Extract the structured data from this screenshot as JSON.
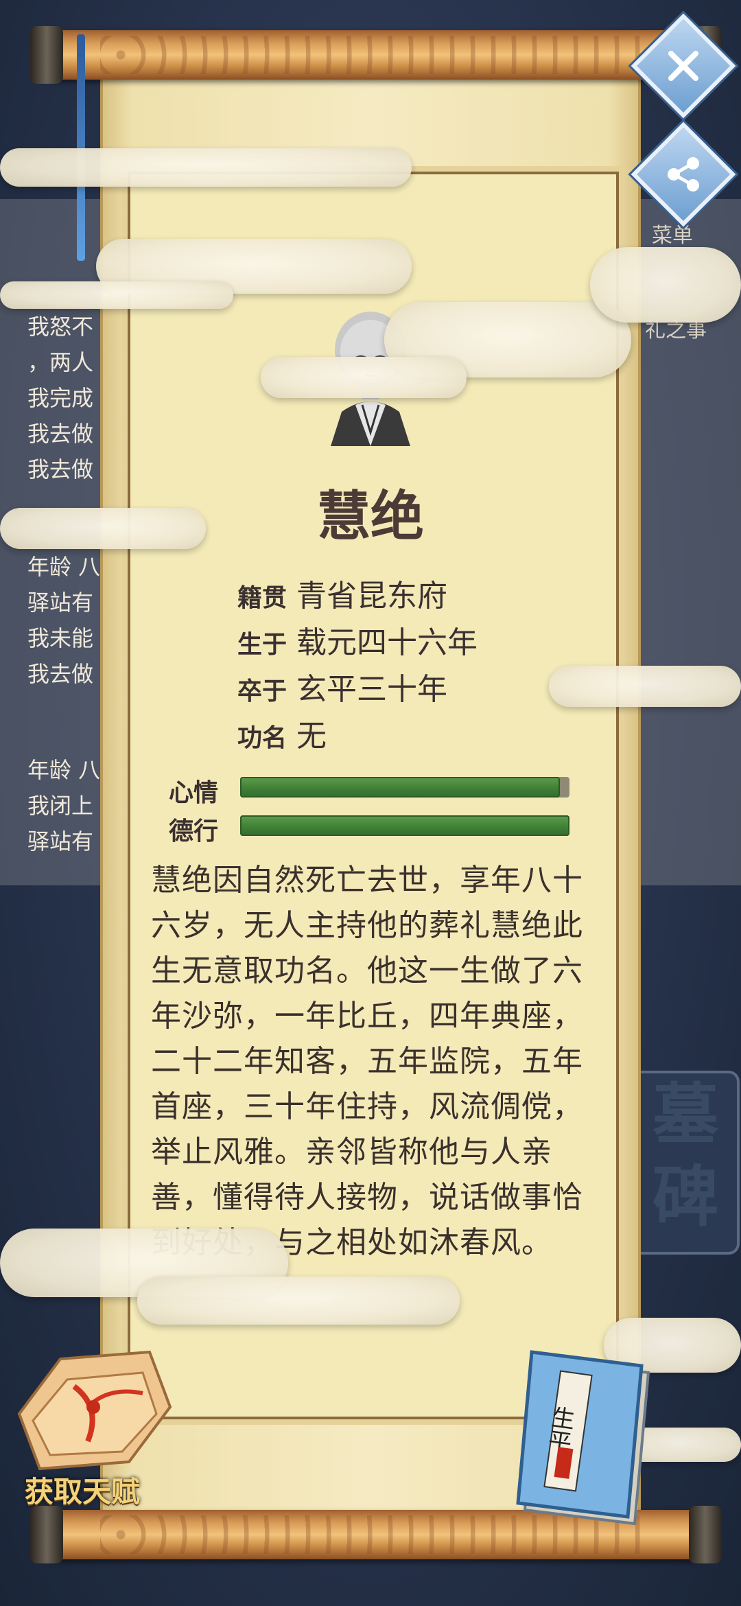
{
  "background": {
    "log_lines_1": [
      "我怒不",
      "，两人",
      "我完成",
      "我去做",
      "我去做"
    ],
    "log_header_2": "年龄 八",
    "log_lines_2": [
      "驿站有",
      "我未能",
      "我去做"
    ],
    "log_header_3": "年龄 八",
    "log_lines_3": [
      "我闭上",
      "驿站有"
    ],
    "right_fragments": [
      "礼之事"
    ],
    "menu_label": "菜单",
    "stele_text": "墓碑"
  },
  "character": {
    "name": "慧绝",
    "fields": [
      {
        "key": "籍贯",
        "value": "青省昆东府"
      },
      {
        "key": "生于",
        "value": "载元四十六年"
      },
      {
        "key": "卒于",
        "value": "玄平三十年"
      },
      {
        "key": "功名",
        "value": "无"
      }
    ],
    "bars": [
      {
        "label": "心情",
        "fill": 0.97
      },
      {
        "label": "德行",
        "fill": 1.0
      }
    ],
    "bio": "慧绝因自然死亡去世，享年八十六岁，无人主持他的葬礼慧绝此生无意取功名。他这一生做了六年沙弥，一年比丘，四年典座，二十二年知客，五年监院，五年首座，三十年住持，风流倜傥，举止风雅。亲邻皆称他与人亲善，懂得待人接物，说话做事恰到好处，与之相处如沐春风。"
  },
  "buttons": {
    "close_icon": "close-icon",
    "share_icon": "share-icon",
    "talent_label": "获取天赋",
    "book_title": "生平"
  },
  "colors": {
    "bar_green": "#3e7f35",
    "scroll_paper": "#f4eab8",
    "button_blue": "#6e9fd1",
    "talent_gold": "#f3d27a"
  }
}
